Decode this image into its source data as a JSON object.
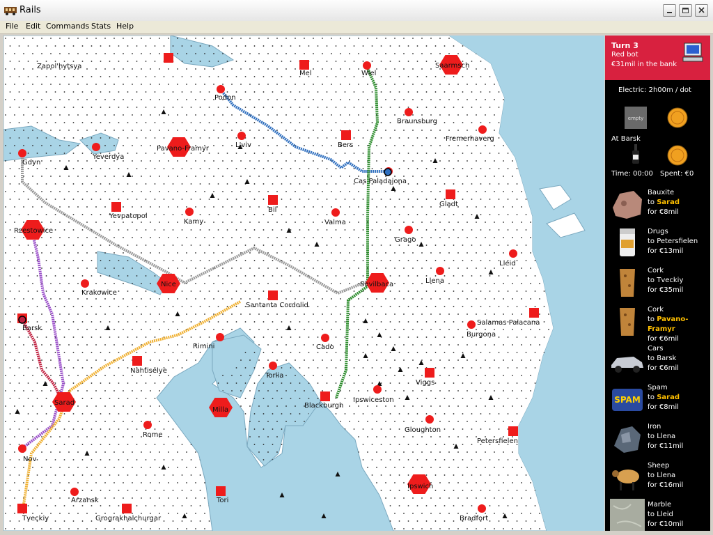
{
  "window": {
    "title": "Rails"
  },
  "menu": [
    "File",
    "Edit",
    "Commands",
    "Stats",
    "Help"
  ],
  "colors": {
    "accent": "#d8213f",
    "sea": "#a9d4e6",
    "land": "#ffffff",
    "city": "#ee1c1c",
    "highlight": "#ffc000"
  },
  "status": {
    "turn": "Turn 3",
    "player": "Red bot",
    "bank": "€31mil in the bank"
  },
  "train": {
    "info": "Electric: 2h00m / dot",
    "slot1": "empty",
    "at_city": "At Barsk",
    "time": "Time: 00:00",
    "spent": "Spent: €0"
  },
  "demands": [
    {
      "cargo": "Bauxite",
      "to": "Sarad",
      "reward": "for €8mil",
      "highlight": true,
      "icon": "bauxite-icon"
    },
    {
      "cargo": "Drugs",
      "to": "Petersfielen",
      "reward": "for €13mil",
      "highlight": false,
      "icon": "drugs-icon"
    },
    {
      "cargo": "Cork",
      "to": "Tveckiy",
      "reward": "for €35mil",
      "highlight": false,
      "icon": "cork-icon"
    },
    {
      "cargo": "Cork",
      "to": "Pavano-Framyr",
      "reward": "for €6mil",
      "highlight": true,
      "icon": "cork-icon"
    },
    {
      "cargo": "Cars",
      "to": "Barsk",
      "reward": "for €6mil",
      "highlight": false,
      "icon": "cars-icon"
    },
    {
      "cargo": "Spam",
      "to": "Sarad",
      "reward": "for €8mil",
      "highlight": true,
      "icon": "spam-icon"
    },
    {
      "cargo": "Iron",
      "to": "Llena",
      "reward": "for €11mil",
      "highlight": false,
      "icon": "iron-icon"
    },
    {
      "cargo": "Sheep",
      "to": "Llena",
      "reward": "for €16mil",
      "highlight": false,
      "icon": "sheep-icon"
    },
    {
      "cargo": "Marble",
      "to": "Lleid",
      "reward": "for €10mil",
      "highlight": false,
      "icon": "marble-icon"
    }
  ],
  "cities": [
    {
      "name": "Zapol'hytsya",
      "kind": "square"
    },
    {
      "name": "Mel",
      "kind": "square"
    },
    {
      "name": "Wiel",
      "kind": "dot"
    },
    {
      "name": "Saarmsch",
      "kind": "hex"
    },
    {
      "name": "Podon",
      "kind": "dot"
    },
    {
      "name": "Braunsburg",
      "kind": "dot"
    },
    {
      "name": "Fremerhaverg",
      "kind": "dot"
    },
    {
      "name": "Yeverdya",
      "kind": "dot"
    },
    {
      "name": "Pavano-Framyr",
      "kind": "hex"
    },
    {
      "name": "L'viv",
      "kind": "dot"
    },
    {
      "name": "Bers",
      "kind": "square"
    },
    {
      "name": "Gdyn",
      "kind": "dot"
    },
    {
      "name": "Cas Paladajona",
      "kind": "dot"
    },
    {
      "name": "Gladt",
      "kind": "square"
    },
    {
      "name": "Yevpatopol",
      "kind": "square"
    },
    {
      "name": "Bil",
      "kind": "square"
    },
    {
      "name": "Kamy",
      "kind": "dot"
    },
    {
      "name": "Valma",
      "kind": "dot"
    },
    {
      "name": "Rzestowice",
      "kind": "hex"
    },
    {
      "name": "Grago",
      "kind": "dot"
    },
    {
      "name": "Lleid",
      "kind": "dot"
    },
    {
      "name": "Nice",
      "kind": "hex"
    },
    {
      "name": "Krakowice",
      "kind": "dot"
    },
    {
      "name": "Sevilbaca",
      "kind": "hex"
    },
    {
      "name": "Llena",
      "kind": "dot"
    },
    {
      "name": "Santanta Cordolid",
      "kind": "square"
    },
    {
      "name": "Barsk",
      "kind": "square"
    },
    {
      "name": "Salamas Palacana",
      "kind": "square"
    },
    {
      "name": "Rimini",
      "kind": "dot"
    },
    {
      "name": "Cado",
      "kind": "dot"
    },
    {
      "name": "Burgona",
      "kind": "dot"
    },
    {
      "name": "Nahtiselye",
      "kind": "square"
    },
    {
      "name": "Torlia",
      "kind": "dot"
    },
    {
      "name": "Viggs",
      "kind": "square"
    },
    {
      "name": "Sarad",
      "kind": "hex"
    },
    {
      "name": "Milla",
      "kind": "hex"
    },
    {
      "name": "Blackburgh",
      "kind": "square"
    },
    {
      "name": "Ipswiceston",
      "kind": "dot"
    },
    {
      "name": "Rome",
      "kind": "dot"
    },
    {
      "name": "Gloughton",
      "kind": "dot"
    },
    {
      "name": "Nov",
      "kind": "dot"
    },
    {
      "name": "Petersfielen",
      "kind": "square"
    },
    {
      "name": "Ipswich",
      "kind": "hex"
    },
    {
      "name": "Arzansk",
      "kind": "dot"
    },
    {
      "name": "Tori",
      "kind": "square"
    },
    {
      "name": "Tveckiy",
      "kind": "square"
    },
    {
      "name": "Grograkhalchurgar",
      "kind": "square"
    },
    {
      "name": "Bradfort",
      "kind": "dot"
    }
  ]
}
